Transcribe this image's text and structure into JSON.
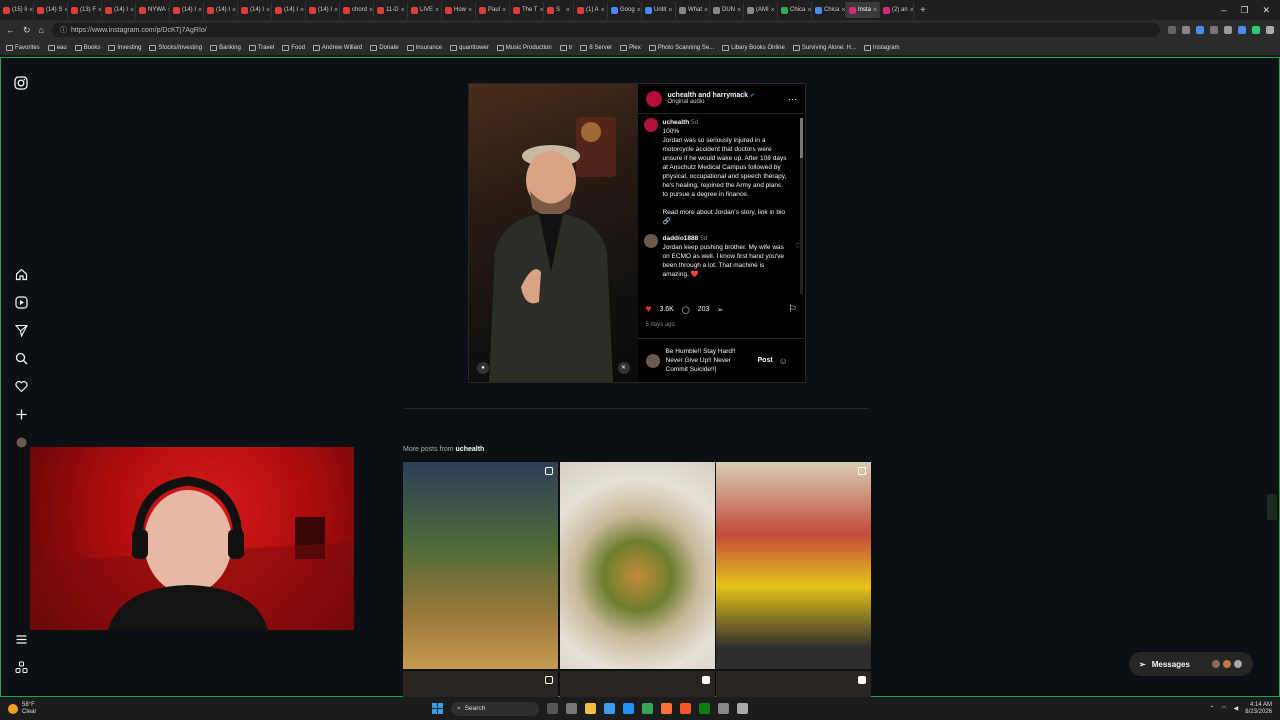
{
  "browser": {
    "tabs": [
      {
        "label": "(15) li",
        "color": "#e23b3b"
      },
      {
        "label": "(14) S",
        "color": "#e23b3b"
      },
      {
        "label": "(13) F",
        "color": "#e23b3b"
      },
      {
        "label": "(14) I",
        "color": "#e23b3b"
      },
      {
        "label": "NYWA",
        "color": "#e23b3b"
      },
      {
        "label": "(14) I",
        "color": "#e23b3b"
      },
      {
        "label": "(14) I",
        "color": "#e23b3b"
      },
      {
        "label": "(14) I",
        "color": "#e23b3b"
      },
      {
        "label": "(14) I",
        "color": "#e23b3b"
      },
      {
        "label": "(14) I",
        "color": "#e23b3b"
      },
      {
        "label": "chord",
        "color": "#e23b3b"
      },
      {
        "label": "11-D",
        "color": "#e23b3b"
      },
      {
        "label": "LIVE",
        "color": "#e23b3b"
      },
      {
        "label": "How",
        "color": "#e23b3b"
      },
      {
        "label": "Paul",
        "color": "#e23b3b"
      },
      {
        "label": "The T",
        "color": "#e23b3b"
      },
      {
        "label": "S",
        "color": "#e23b3b"
      },
      {
        "label": "(1) A",
        "color": "#e23b3b"
      },
      {
        "label": "Goog",
        "color": "#4a8af4"
      },
      {
        "label": "Untit",
        "color": "#4a8af4"
      },
      {
        "label": "What",
        "color": "#888888"
      },
      {
        "label": "DUN",
        "color": "#888888"
      },
      {
        "label": "(AMI",
        "color": "#888888"
      },
      {
        "label": "Chica",
        "color": "#34a853"
      },
      {
        "label": "Chica",
        "color": "#4a8af4"
      },
      {
        "label": "Insta",
        "color": "#d62976",
        "active": true
      },
      {
        "label": "(2) an",
        "color": "#d62976"
      }
    ],
    "url": "https://www.instagram.com/p/DcKTj7AgRIo/",
    "bookmarks": [
      "Favorites",
      "eau",
      "Books",
      "Investing",
      "Stocks/Investing",
      "Banking",
      "Travel",
      "Food",
      "Andrew Willard",
      "Donate",
      "Insurance",
      "quanttower",
      "Music Production",
      "tr",
      "8 Server",
      "Plex",
      "Photo Scanning Se...",
      "Libary Books Online",
      "Surviving Alone: H...",
      "Instagram"
    ]
  },
  "post": {
    "header_accounts": "uchealth and harrymack",
    "header_sub": "Original audio",
    "comments": [
      {
        "user": "uchealth",
        "time": "5d",
        "text": "100%\nJordan was so seriously injured in a motorcycle accident that doctors were unsure if he would wake up. After 108 days at Anschutz Medical Campus followed by physical, occupational and speech therapy, he's healing, rejoined the Army and plans to pursue a degree in finance.\n\nRead more about Jordan's story, link in bio 🔗"
      },
      {
        "user": "daddio1888",
        "time": "5d",
        "text": "Jordan keep pushing brother. My wife was on ECMO as well. I know first hand you've been through a lot. That machine is amazing. ❤️"
      }
    ],
    "likes": "3.6K",
    "comment_count": "203",
    "posted_ago": "5 days ago",
    "draft_comment": "Be Humble!! Stay Hard!! Never Give Up!! Never Commit Suicide!!|",
    "post_button": "Post",
    "accent": "#ff3040"
  },
  "more_posts": {
    "prefix": "More posts from",
    "account": "uchealth"
  },
  "messages_label": "Messages",
  "taskbar": {
    "temp": "58°F",
    "condition": "Clear",
    "search": "Search",
    "time": "4:14 AM",
    "date": "8/23/2026"
  }
}
